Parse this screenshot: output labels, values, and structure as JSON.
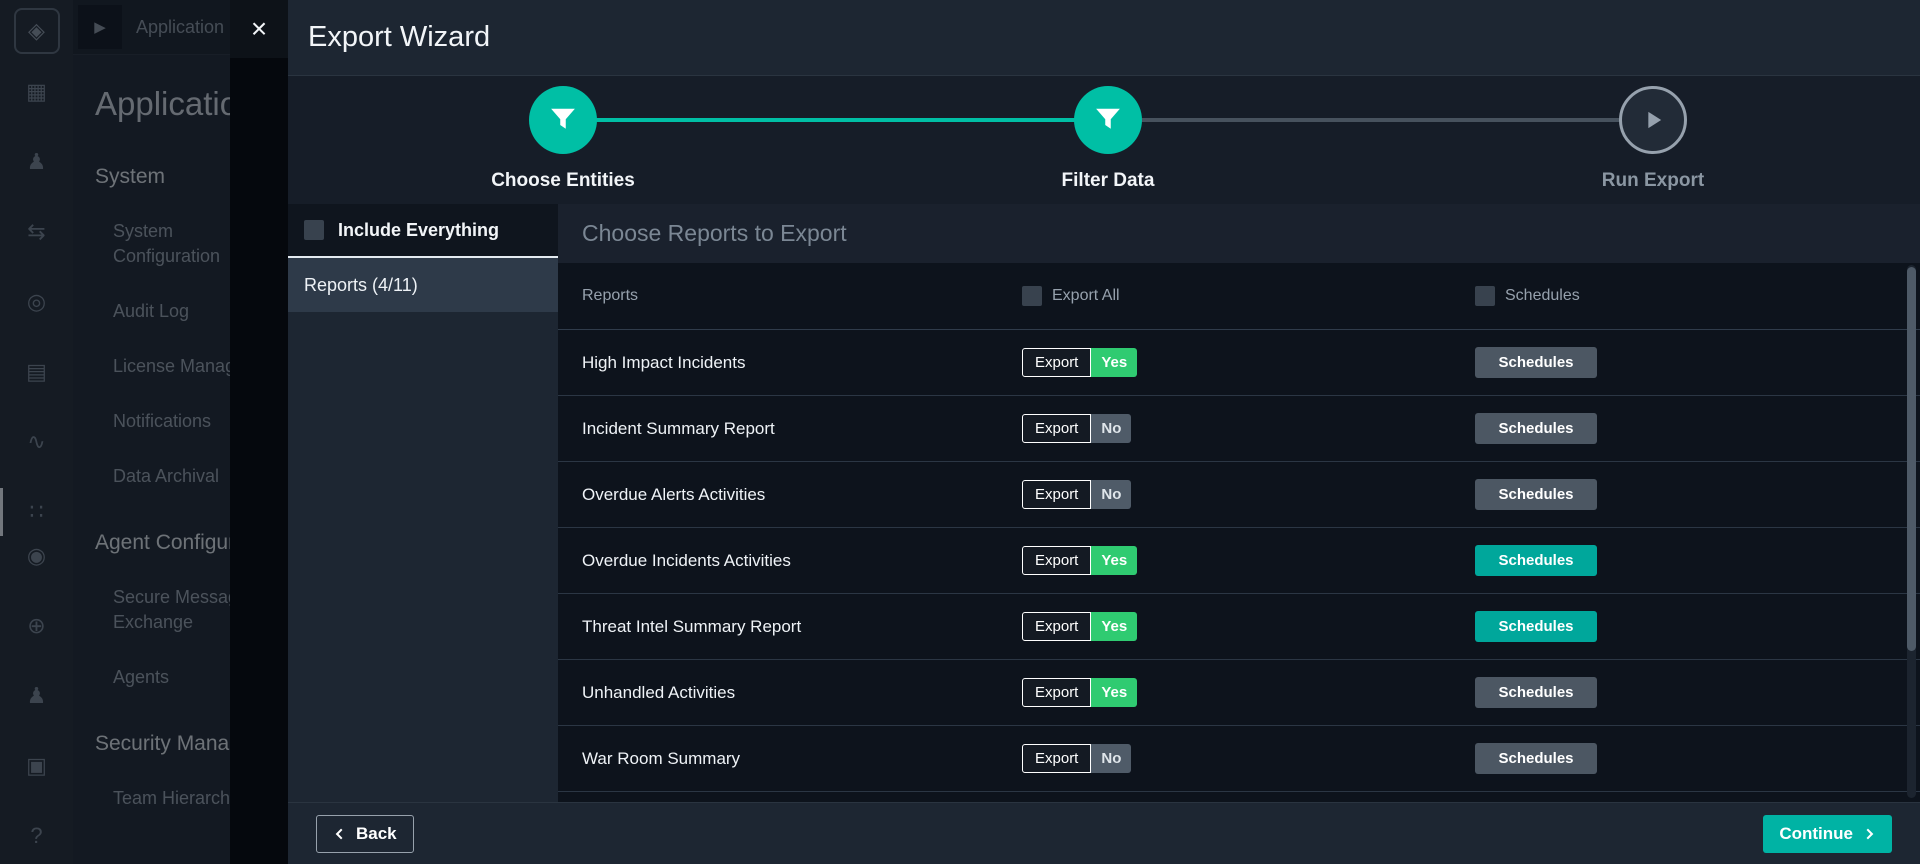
{
  "colors": {
    "accent_teal": "#00BFA5",
    "button_teal": "#00A79B",
    "success_green": "#2FCB71",
    "badge_gray": "#4F5B68",
    "modal_surface": "#161D28",
    "panel_dark": "#1D2632",
    "table_dark": "#0D131C"
  },
  "background": {
    "breadcrumb": "Application",
    "page_title": "Application",
    "rail_icons_top": [
      {
        "name": "dashboard",
        "glyph": "▦",
        "active": false
      },
      {
        "name": "queues",
        "glyph": "♟",
        "active": false
      },
      {
        "name": "workflow",
        "glyph": "⇆",
        "active": false
      },
      {
        "name": "automation",
        "glyph": "◎",
        "active": false
      },
      {
        "name": "resources",
        "glyph": "▤",
        "active": false
      },
      {
        "name": "reports",
        "glyph": "∿",
        "active": false
      },
      {
        "name": "modules",
        "glyph": "∷",
        "active": true
      }
    ],
    "rail_icons_bottom": [
      {
        "name": "navigator",
        "glyph": "◉",
        "active": false
      },
      {
        "name": "connectors",
        "glyph": "⊕",
        "active": false
      },
      {
        "name": "user-community",
        "glyph": "♟",
        "active": false
      },
      {
        "name": "audit",
        "glyph": "▣",
        "active": false
      },
      {
        "name": "help",
        "glyph": "?",
        "active": false
      }
    ],
    "logo_glyph": "◈",
    "crumb_play_glyph": "▶",
    "nav_sections": [
      {
        "title": "System",
        "items": [
          "System Configuration",
          "Audit Log",
          "License Manager",
          "Notifications",
          "Data Archival"
        ]
      },
      {
        "title": "Agent Configuration",
        "items": [
          "Secure Message Exchange",
          "Agents"
        ]
      },
      {
        "title": "Security Management",
        "items": [
          "Team Hierarchy"
        ]
      }
    ]
  },
  "modal": {
    "title": "Export Wizard",
    "close_glyph": "×",
    "steps": [
      {
        "label": "Choose Entities",
        "icon": "filter-icon",
        "state": "done"
      },
      {
        "label": "Filter Data",
        "icon": "filter-icon",
        "state": "active"
      },
      {
        "label": "Run Export",
        "icon": "play-icon",
        "state": "upcoming"
      }
    ],
    "sidebar": {
      "include_everything": "Include Everything",
      "reports_tab": "Reports (4/11)"
    },
    "content": {
      "heading": "Choose Reports to Export",
      "table": {
        "name_header": "Reports",
        "export_all_label": "Export All",
        "schedules_header_label": "Schedules",
        "export_button_label": "Export",
        "schedules_button_label": "Schedules",
        "rows": [
          {
            "name": "High Impact Incidents",
            "export_label": "Yes",
            "export_on": true,
            "schedules_active": false
          },
          {
            "name": "Incident Summary Report",
            "export_label": "No",
            "export_on": false,
            "schedules_active": false
          },
          {
            "name": "Overdue Alerts Activities",
            "export_label": "No",
            "export_on": false,
            "schedules_active": false
          },
          {
            "name": "Overdue Incidents Activities",
            "export_label": "Yes",
            "export_on": true,
            "schedules_active": true
          },
          {
            "name": "Threat Intel Summary Report",
            "export_label": "Yes",
            "export_on": true,
            "schedules_active": true
          },
          {
            "name": "Unhandled Activities",
            "export_label": "Yes",
            "export_on": true,
            "schedules_active": false
          },
          {
            "name": "War Room Summary",
            "export_label": "No",
            "export_on": false,
            "schedules_active": false
          }
        ]
      }
    },
    "footer": {
      "back_label": "Back",
      "continue_label": "Continue"
    }
  }
}
